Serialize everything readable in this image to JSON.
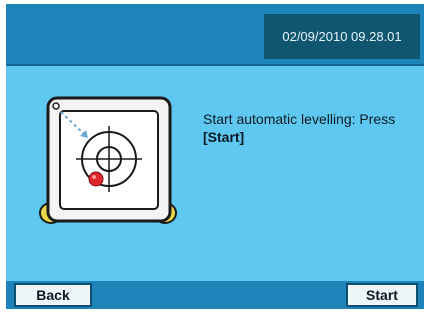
{
  "header": {
    "datetime": "02/09/2010 09.28.01"
  },
  "main": {
    "message_line1": "Start automatic levelling: Press",
    "message_line2": "[Start]",
    "illustration_icon": "level-indicator-icon"
  },
  "footer": {
    "back_label": "Back",
    "start_label": "Start"
  },
  "colors": {
    "background": "#5ec8f0",
    "header": "#1d85ba",
    "datetime_box": "#0f566e",
    "bubble": "#e0262a",
    "feet": "#e8d84a"
  }
}
